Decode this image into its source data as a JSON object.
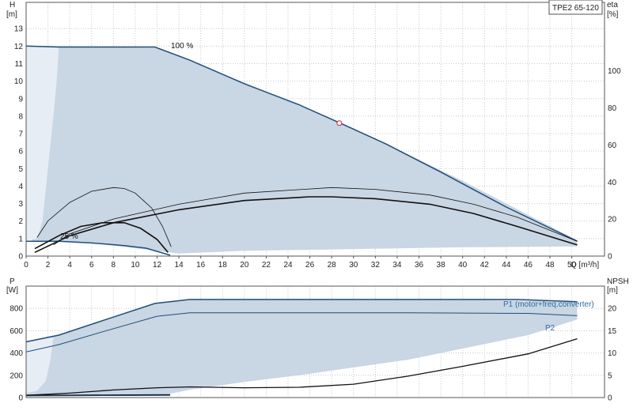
{
  "chart_data": [
    {
      "type": "line",
      "name": "performance",
      "model_label": "TPE2 65-120",
      "flow_label": "Q [m³/h]",
      "ylabel": "H",
      "yunit": "[m]",
      "ylabel_right": "eta",
      "yunit_right": "[%]",
      "xlim": [
        0,
        53
      ],
      "ylim": [
        0,
        14.5
      ],
      "ylim_right": [
        0,
        137
      ],
      "x_ticks": [
        0,
        2,
        4,
        6,
        8,
        10,
        12,
        14,
        16,
        18,
        20,
        22,
        24,
        26,
        28,
        30,
        32,
        34,
        36,
        38,
        40,
        42,
        44,
        46,
        48,
        50
      ],
      "y_ticks": [
        0,
        1,
        2,
        3,
        4,
        5,
        6,
        7,
        8,
        9,
        10,
        11,
        12,
        13
      ],
      "y_right_ticks": [
        0,
        20,
        40,
        60,
        80,
        100
      ],
      "grid": true,
      "curve_label_max": "100 %",
      "curve_label_min": "25 %",
      "operating_envelope": [
        [
          0.5,
          12.0
        ],
        [
          3.0,
          12.0
        ],
        [
          12.0,
          11.9
        ],
        [
          15.0,
          11.2
        ],
        [
          20.0,
          9.9
        ],
        [
          30.0,
          7.3
        ],
        [
          40.0,
          4.3
        ],
        [
          50.5,
          0.9
        ],
        [
          50.5,
          0.55
        ],
        [
          40.0,
          0.5
        ],
        [
          30.0,
          0.4
        ],
        [
          20.0,
          0.3
        ],
        [
          14.0,
          0.15
        ],
        [
          12.0,
          0.3
        ],
        [
          6.0,
          0.75
        ],
        [
          3.0,
          0.85
        ],
        [
          0.5,
          0.85
        ]
      ],
      "light_region": [
        [
          0.0,
          12.0
        ],
        [
          3.0,
          12.0
        ],
        [
          2.8,
          10.0
        ],
        [
          2.5,
          8.0
        ],
        [
          2.0,
          5.0
        ],
        [
          1.5,
          2.0
        ],
        [
          1.0,
          1.0
        ],
        [
          0.0,
          0.9
        ]
      ],
      "h_max_curve": [
        [
          0.0,
          12.0
        ],
        [
          3.0,
          11.95
        ],
        [
          8.0,
          11.95
        ],
        [
          11.8,
          11.95
        ],
        [
          15.0,
          11.2
        ],
        [
          20.0,
          9.85
        ],
        [
          25.0,
          8.65
        ],
        [
          28.8,
          7.6
        ],
        [
          33.0,
          6.4
        ],
        [
          38.0,
          4.8
        ],
        [
          44.0,
          2.8
        ],
        [
          50.5,
          0.85
        ]
      ],
      "h_min_curve": [
        [
          0.0,
          0.85
        ],
        [
          3.0,
          0.85
        ],
        [
          6.0,
          0.75
        ],
        [
          9.0,
          0.6
        ],
        [
          11.0,
          0.45
        ],
        [
          13.2,
          0.05
        ]
      ],
      "eta_max_curve": [
        [
          2.5,
          6
        ],
        [
          4.0,
          12
        ],
        [
          8.0,
          20
        ],
        [
          14.0,
          28
        ],
        [
          20.0,
          34
        ],
        [
          28.0,
          37
        ],
        [
          32.0,
          36
        ],
        [
          37.0,
          33
        ],
        [
          41.0,
          28
        ],
        [
          45.0,
          21
        ],
        [
          50.5,
          8
        ]
      ],
      "eta_max_inverter_curve": [
        [
          0.8,
          2
        ],
        [
          4.0,
          11
        ],
        [
          8.0,
          18
        ],
        [
          14.0,
          25
        ],
        [
          20.0,
          30
        ],
        [
          26.0,
          32
        ],
        [
          28.0,
          32
        ],
        [
          32.0,
          31
        ],
        [
          37.0,
          28
        ],
        [
          41.0,
          23
        ],
        [
          45.0,
          16
        ],
        [
          50.5,
          6
        ]
      ],
      "eta_min_curve": [
        [
          1.0,
          10
        ],
        [
          2.0,
          19
        ],
        [
          4.0,
          29
        ],
        [
          6.0,
          35
        ],
        [
          8.0,
          37
        ],
        [
          9.0,
          36.5
        ],
        [
          10.0,
          34
        ],
        [
          11.5,
          26
        ],
        [
          12.5,
          16
        ],
        [
          13.3,
          5
        ]
      ],
      "eta_min_inverter_curve": [
        [
          0.8,
          4
        ],
        [
          3.0,
          11
        ],
        [
          5.0,
          16
        ],
        [
          7.0,
          18
        ],
        [
          9.0,
          18
        ],
        [
          10.5,
          15
        ],
        [
          12.0,
          9
        ],
        [
          13.0,
          2
        ]
      ],
      "duty_point": [
        28.7,
        7.6
      ]
    },
    {
      "type": "line",
      "name": "power_npsh",
      "ylabel": "P",
      "yunit": "[W]",
      "ylabel_right": "NPSH",
      "yunit_right": "[m]",
      "xlim": [
        0,
        53
      ],
      "ylim": [
        0,
        1000
      ],
      "ylim_right": [
        0,
        25
      ],
      "y_ticks": [
        0,
        200,
        400,
        600,
        800
      ],
      "y_right_ticks": [
        0,
        5,
        10,
        15,
        20
      ],
      "grid": true,
      "p1_label": "P1 (motor+freq.converter)",
      "p2_label": "P2",
      "power_envelope": [
        [
          0.0,
          500
        ],
        [
          3.0,
          560
        ],
        [
          7.0,
          690
        ],
        [
          11.8,
          845
        ],
        [
          15.0,
          880
        ],
        [
          25.0,
          880
        ],
        [
          40.0,
          880
        ],
        [
          50.5,
          860
        ],
        [
          50.5,
          700
        ],
        [
          46.0,
          560
        ],
        [
          40.0,
          440
        ],
        [
          35.0,
          340
        ],
        [
          30.0,
          270
        ],
        [
          25.0,
          200
        ],
        [
          20.0,
          140
        ],
        [
          15.0,
          70
        ],
        [
          13.0,
          30
        ],
        [
          10.0,
          25
        ],
        [
          5.0,
          25
        ],
        [
          0.0,
          25
        ]
      ],
      "light_region": [
        [
          0.0,
          500
        ],
        [
          2.5,
          540
        ],
        [
          2.2,
          320
        ],
        [
          1.8,
          150
        ],
        [
          1.0,
          60
        ],
        [
          0.0,
          40
        ]
      ],
      "p1_max_curve": [
        [
          0.0,
          500
        ],
        [
          3.0,
          560
        ],
        [
          7.0,
          690
        ],
        [
          11.8,
          845
        ],
        [
          15.0,
          880
        ],
        [
          25.0,
          880
        ],
        [
          35.0,
          880
        ],
        [
          45.0,
          880
        ],
        [
          50.5,
          860
        ]
      ],
      "p2_max_curve": [
        [
          0.0,
          410
        ],
        [
          3.0,
          475
        ],
        [
          7.0,
          590
        ],
        [
          12.0,
          730
        ],
        [
          15.0,
          760
        ],
        [
          25.0,
          760
        ],
        [
          35.0,
          760
        ],
        [
          46.0,
          755
        ],
        [
          50.5,
          735
        ]
      ],
      "p1_min_curve": [
        [
          0.0,
          20
        ],
        [
          4.0,
          20
        ],
        [
          8.0,
          22
        ],
        [
          13.2,
          25
        ]
      ],
      "p2_min_curve": [
        [
          0.0,
          15
        ],
        [
          4.0,
          16
        ],
        [
          8.0,
          18
        ],
        [
          13.2,
          20
        ]
      ],
      "npsh_curve": [
        [
          0.0,
          0.5
        ],
        [
          4.0,
          1.0
        ],
        [
          8.0,
          1.7
        ],
        [
          12.0,
          2.2
        ],
        [
          15.0,
          2.4
        ],
        [
          20.0,
          2.2
        ],
        [
          25.0,
          2.3
        ],
        [
          30.0,
          3.0
        ],
        [
          35.0,
          4.8
        ],
        [
          40.0,
          7.0
        ],
        [
          46.0,
          9.8
        ],
        [
          50.5,
          13.2
        ]
      ]
    }
  ],
  "colors": {
    "envelope_fill": "#c9d6e3",
    "light_fill": "#e6edf5",
    "curve_blue": "#1f4e79",
    "curve_black": "#111111",
    "label_blue": "#2e6da4",
    "duty_point": "#d62728"
  }
}
